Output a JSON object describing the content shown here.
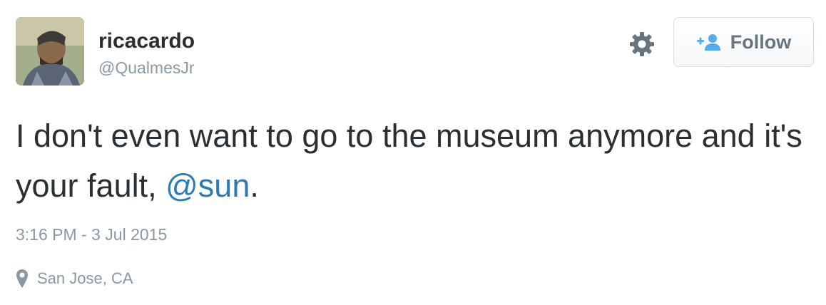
{
  "user": {
    "display_name": "ricacardo",
    "screen_name": "@QualmesJr",
    "avatar_icon": "user-avatar-photo"
  },
  "actions": {
    "settings_icon": "gear-icon",
    "follow_label": "Follow",
    "follow_icon": "add-user-icon"
  },
  "tweet": {
    "text_before": "I don't even want to go to the museum anymore and it's your fault, ",
    "mention": "@sun",
    "text_after": ".",
    "timestamp": "3:16 PM - 3 Jul 2015",
    "location": "San Jose, CA",
    "location_icon": "map-pin-icon"
  },
  "colors": {
    "text": "#292f33",
    "muted": "#8899a6",
    "link": "#2b7bb9",
    "follow_accent": "#55acee"
  }
}
